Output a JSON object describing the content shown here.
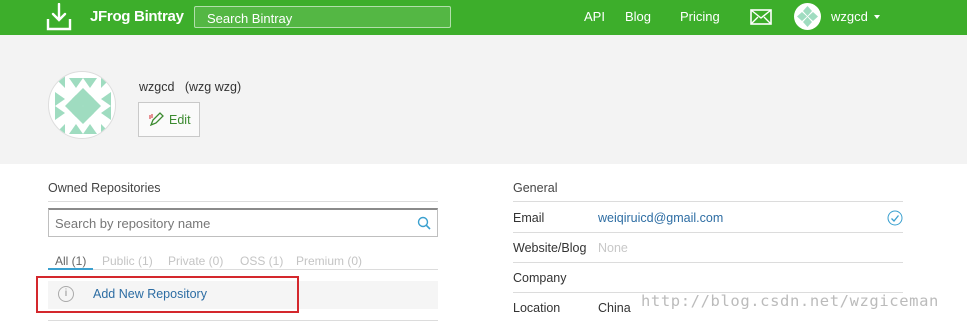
{
  "header": {
    "logo_text": "JFrog Bintray",
    "search_placeholder": "Search Bintray",
    "nav": [
      "API",
      "Blog",
      "Pricing"
    ],
    "username": "wzgcd"
  },
  "profile": {
    "display": "wzgcd   (wzg wzg)",
    "edit_label": "Edit"
  },
  "owned": {
    "title": "Owned Repositories",
    "search_placeholder": "Search by repository name",
    "tabs": [
      "All (1)",
      "Public (1)",
      "Private (0)",
      "OSS (1)",
      "Premium (0)"
    ],
    "active_tab": "All (1)",
    "add_label": "Add New Repository",
    "info_glyph": "i"
  },
  "general": {
    "title": "General",
    "rows": [
      {
        "label": "Email",
        "value": "weiqiruicd@gmail.com"
      },
      {
        "label": "Website/Blog",
        "value": "None"
      },
      {
        "label": "Company",
        "value": ""
      },
      {
        "label": "Location",
        "value": "China"
      }
    ]
  },
  "watermark": "http://blog.csdn.net/wzgiceman",
  "colors": {
    "brand_green": "#3dae2b",
    "link_blue": "#2d6da3",
    "highlight_red": "#d4282d",
    "avatar_pattern": "#9fdcc0"
  },
  "icons": [
    "download-logo-icon",
    "mail-icon",
    "pencil-icon",
    "search-icon",
    "info-icon",
    "verified-check-icon",
    "caret-down-icon"
  ]
}
